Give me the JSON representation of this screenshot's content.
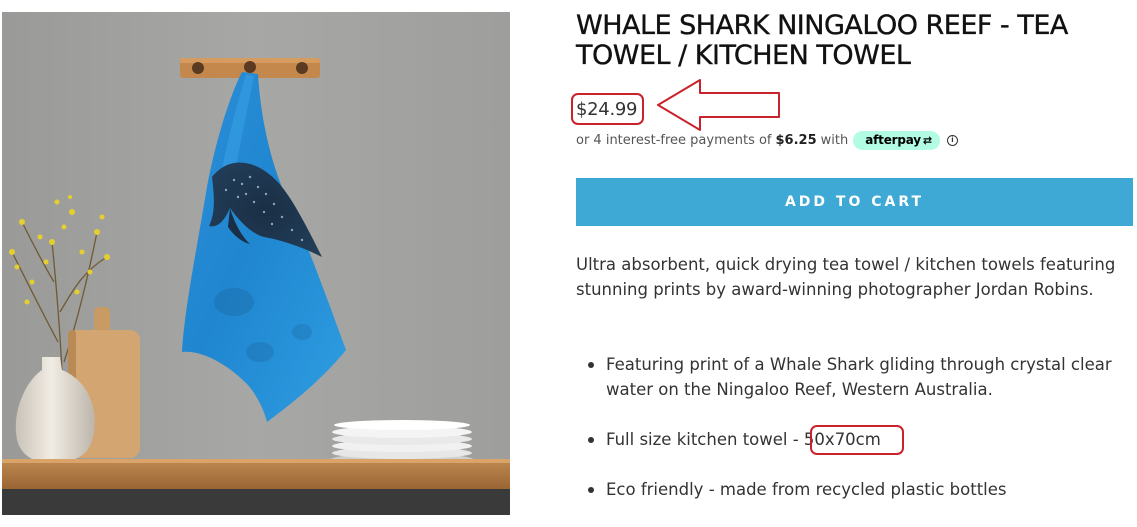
{
  "product": {
    "image_alt": "Whale shark tea towel hanging on a wooden hook rail",
    "title": "WHALE SHARK NINGALOO REEF - TEA TOWEL / KITCHEN TOWEL",
    "price": "$24.99",
    "installments": {
      "prefix": "or 4 interest-free payments of",
      "amount": "$6.25",
      "suffix": "with",
      "provider": "afterpay",
      "provider_mark": "⇄",
      "info_symbol": "i"
    },
    "add_to_cart_label": "ADD TO CART",
    "description": "Ultra absorbent, quick drying tea towel / kitchen towels featuring stunning prints by award-winning photographer Jordan Robins.",
    "features": [
      "Featuring print of a Whale Shark gliding through crystal clear water on the Ningaloo Reef, Western Australia.",
      "Full size kitchen towel - 50x70cm",
      "Eco friendly - made from recycled plastic bottles"
    ]
  },
  "colors": {
    "accent": "#3fa9d5",
    "afterpay": "#b2fce4",
    "annotation": "#c8222c",
    "text": "#333333"
  }
}
